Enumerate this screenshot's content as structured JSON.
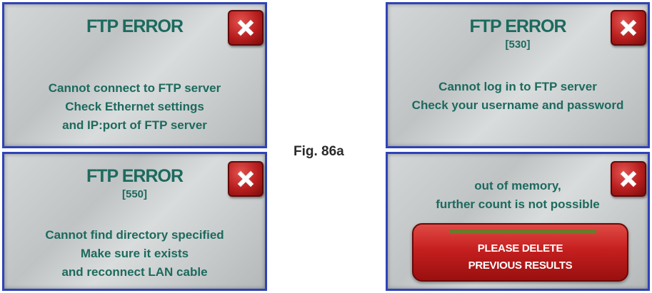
{
  "figure_label": "Fig. 86a",
  "dialogs": [
    {
      "title": "FTP ERROR",
      "code": "",
      "lines": [
        "Cannot connect to FTP server",
        "Check Ethernet settings",
        "and IP:port of FTP server"
      ]
    },
    {
      "title": "FTP ERROR",
      "code": "[550]",
      "lines": [
        "Cannot find directory specified",
        "Make sure it exists",
        "and reconnect LAN cable"
      ]
    },
    {
      "title": "FTP ERROR",
      "code": "[530]",
      "lines": [
        "Cannot log in to FTP server",
        "Check your username and password"
      ]
    },
    {
      "title": "",
      "code": "",
      "lines": [
        "out of memory,",
        "further count is not possible"
      ],
      "button_lines": [
        "PLEASE DELETE",
        "PREVIOUS RESULTS"
      ],
      "progress": 1.0
    }
  ],
  "icons": {
    "close": "close-x-icon"
  },
  "colors": {
    "text": "#1c6a5e",
    "border": "#2f43b8",
    "close_button": "#b81e1e",
    "delete_button": "#c51f1f"
  }
}
